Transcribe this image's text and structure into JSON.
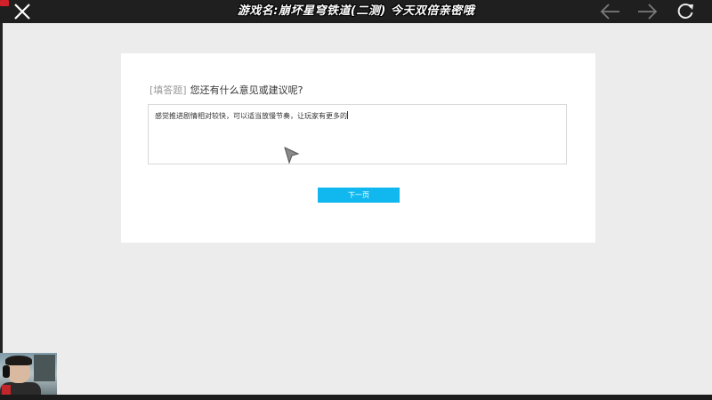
{
  "topbar": {
    "title": "游戏名:崩坏星穹铁道(二测)  今天双倍亲密哦",
    "icons": {
      "close": "close-icon",
      "back": "arrow-left-icon",
      "forward": "arrow-right-icon",
      "refresh": "refresh-icon"
    }
  },
  "survey": {
    "question_tag": "[填答题]",
    "question_text": "您还有什么意见或建议呢?",
    "answer_value": "感觉推进剧情相对较快，可以适当放慢节奏，让玩家有更多的",
    "next_button_label": "下一页"
  },
  "colors": {
    "accent": "#10b8ef",
    "topbar": "#1f1f1f",
    "background": "#ececec"
  }
}
